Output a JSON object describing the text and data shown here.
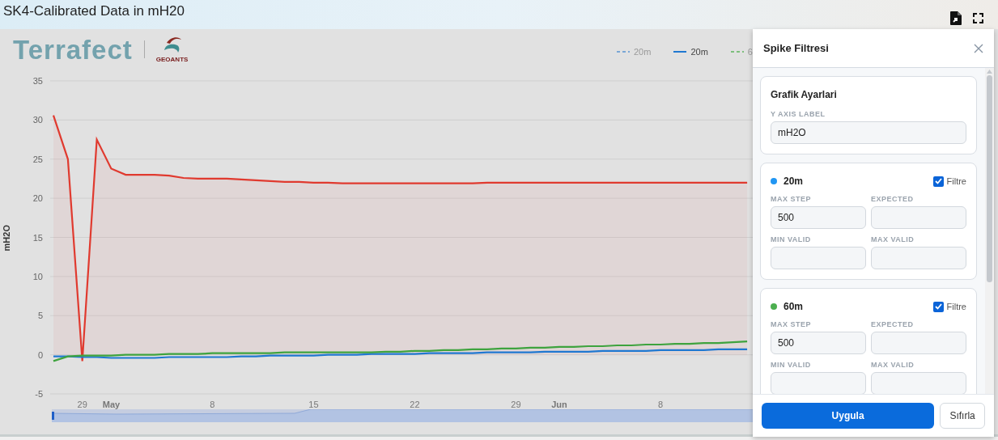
{
  "window": {
    "title": "SK4-Calibrated Data in mH20"
  },
  "logo": {
    "brand": "Terrafect",
    "partner": "GEOANTS"
  },
  "legend": [
    {
      "label": "20m",
      "color": "#7aa7d6",
      "kind": "dashed",
      "dimmed": true
    },
    {
      "label": "20m",
      "color": "#1f78d1",
      "kind": "solid",
      "dimmed": false
    },
    {
      "label": "6",
      "color": "#7dbf7d",
      "kind": "dashed",
      "dimmed": true
    }
  ],
  "chart": {
    "chart_data": {
      "type": "line",
      "grid": true,
      "ylabel": "mH2O",
      "ylim": [
        -5,
        35
      ],
      "yticks": [
        -5,
        0,
        5,
        10,
        15,
        20,
        25,
        30,
        35
      ],
      "categories": [
        null,
        null,
        "29",
        null,
        "May",
        null,
        null,
        null,
        null,
        null,
        null,
        "8",
        null,
        null,
        null,
        null,
        null,
        null,
        "15",
        null,
        null,
        null,
        null,
        null,
        null,
        "22",
        null,
        null,
        null,
        null,
        null,
        null,
        "29",
        null,
        null,
        "Jun",
        null,
        null,
        null,
        null,
        null,
        null,
        "8",
        null,
        null,
        null,
        null,
        null,
        null
      ],
      "series": [
        {
          "color": "#e03a2f",
          "type": "area",
          "values": [
            30.6,
            25.0,
            -0.8,
            27.5,
            23.8,
            23.0,
            23.0,
            23.0,
            22.9,
            22.6,
            22.5,
            22.5,
            22.5,
            22.4,
            22.3,
            22.2,
            22.1,
            22.1,
            22.0,
            22.0,
            21.9,
            21.9,
            21.9,
            21.9,
            21.9,
            21.9,
            21.9,
            21.9,
            21.9,
            21.9,
            22.0,
            22.0,
            22.0,
            22.0,
            22.0,
            22.0,
            22.0,
            22.0,
            22.0,
            22.0,
            22.0,
            22.0,
            22.0,
            22.0,
            22.0,
            22.0,
            22.0,
            22.0,
            22.0
          ]
        },
        {
          "color": "#1f78d1",
          "type": "line",
          "values": [
            -0.2,
            -0.2,
            -0.3,
            -0.3,
            -0.4,
            -0.4,
            -0.4,
            -0.4,
            -0.3,
            -0.3,
            -0.3,
            -0.3,
            -0.3,
            -0.2,
            -0.2,
            -0.1,
            -0.1,
            -0.1,
            -0.1,
            0.0,
            0.0,
            0.0,
            0.1,
            0.1,
            0.1,
            0.1,
            0.2,
            0.2,
            0.2,
            0.2,
            0.3,
            0.3,
            0.3,
            0.3,
            0.4,
            0.4,
            0.4,
            0.4,
            0.5,
            0.5,
            0.5,
            0.5,
            0.6,
            0.6,
            0.6,
            0.6,
            0.7,
            0.7,
            0.7
          ]
        },
        {
          "color": "#3ea33e",
          "type": "line",
          "values": [
            -0.8,
            -0.2,
            -0.1,
            -0.1,
            -0.1,
            0.0,
            0.0,
            0.0,
            0.1,
            0.1,
            0.1,
            0.2,
            0.2,
            0.2,
            0.2,
            0.2,
            0.3,
            0.3,
            0.3,
            0.3,
            0.3,
            0.3,
            0.3,
            0.4,
            0.4,
            0.5,
            0.5,
            0.6,
            0.6,
            0.7,
            0.7,
            0.8,
            0.8,
            0.9,
            0.9,
            1.0,
            1.0,
            1.1,
            1.1,
            1.2,
            1.2,
            1.3,
            1.3,
            1.4,
            1.4,
            1.5,
            1.5,
            1.6,
            1.7
          ]
        }
      ]
    }
  },
  "panel": {
    "title": "Spike Filtresi",
    "settings": {
      "title": "Grafik Ayarlari",
      "fields": [
        {
          "label": "Y AXIS LABEL",
          "value": "mH2O"
        }
      ]
    },
    "filters": [
      {
        "name": "20m",
        "color": "#2196f3",
        "filter_label": "Filtre",
        "checked": true,
        "fields": [
          {
            "label": "MAX STEP",
            "value": "500"
          },
          {
            "label": "EXPECTED"
          },
          {
            "label": "MIN VALID"
          },
          {
            "label": "MAX VALID"
          }
        ]
      },
      {
        "name": "60m",
        "color": "#4caf50",
        "filter_label": "Filtre",
        "checked": true,
        "fields": [
          {
            "label": "MAX STEP",
            "value": "500"
          },
          {
            "label": "EXPECTED"
          },
          {
            "label": "MIN VALID"
          },
          {
            "label": "MAX VALID"
          }
        ]
      }
    ],
    "buttons": [
      {
        "label": "Uygula",
        "kind": "primary"
      },
      {
        "label": "Sıfırla",
        "kind": "secondary"
      }
    ]
  }
}
